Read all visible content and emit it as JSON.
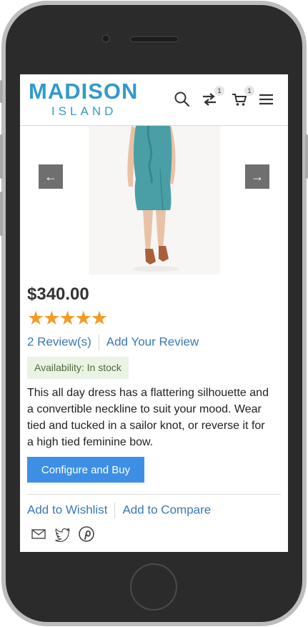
{
  "header": {
    "logo_main": "MADISON",
    "logo_sub": "ISLAND",
    "compare_count": "1",
    "cart_count": "1",
    "icons": [
      "search-icon",
      "compare-icon",
      "cart-icon",
      "menu-icon"
    ]
  },
  "gallery": {
    "prev_icon": "←",
    "next_icon": "→"
  },
  "product": {
    "price": "$340.00",
    "rating": 5,
    "rating_max": 5,
    "reviews_link": "2 Review(s)",
    "add_review_link": "Add Your Review",
    "availability": "Availability: In stock",
    "description": "This all day dress has a flattering silhouette and a convertible neckline to suit your mood. Wear tied and tucked in a sailor knot, or reverse it for a high tied feminine bow.",
    "configure_button": "Configure and Buy",
    "wishlist_link": "Add to Wishlist",
    "compare_link": "Add to Compare"
  },
  "share_icons": [
    "email-icon",
    "twitter-icon",
    "pinterest-icon"
  ],
  "colors": {
    "brand": "#3399cc",
    "link": "#3a78b5",
    "button": "#3d8fe6",
    "star": "#f39c25",
    "stock_bg": "#eaf3e4"
  }
}
